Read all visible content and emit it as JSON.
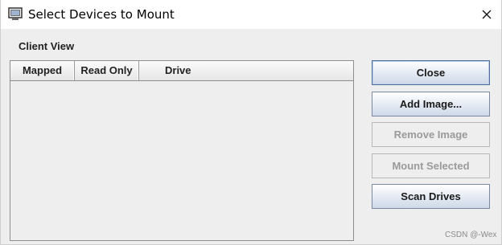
{
  "window": {
    "title": "Select Devices to Mount",
    "icon": "monitor-icon",
    "close_icon": "close-icon"
  },
  "client_view": {
    "label": "Client View",
    "columns": [
      "Mapped",
      "Read Only",
      "Drive"
    ],
    "rows": []
  },
  "buttons": {
    "close": "Close",
    "add_image": "Add Image...",
    "remove_image": "Remove Image",
    "mount_selected": "Mount Selected",
    "scan_drives": "Scan Drives"
  },
  "watermark": "CSDN @-Wex"
}
